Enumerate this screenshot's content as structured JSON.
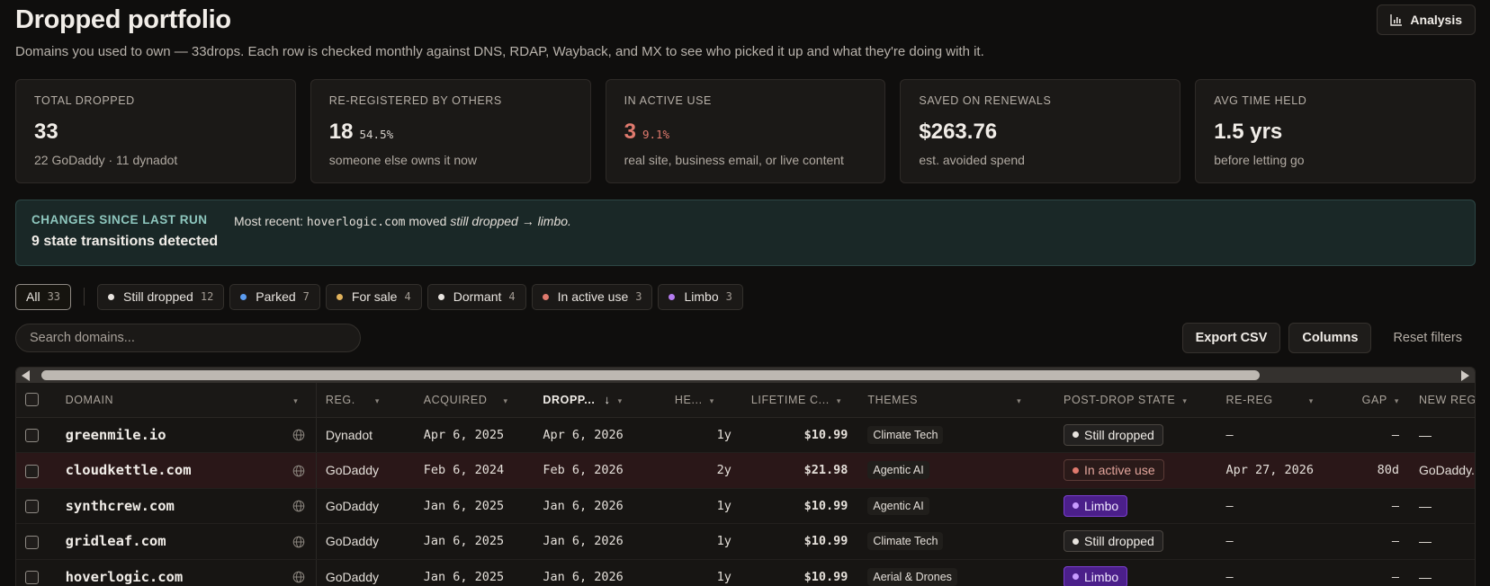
{
  "header": {
    "title": "Dropped portfolio",
    "subtitle": "Domains you used to own — 33drops. Each row is checked monthly against DNS, RDAP, Wayback, and MX to see who picked it up and what they're doing with it.",
    "analysis_label": "Analysis"
  },
  "cards": [
    {
      "label": "TOTAL DROPPED",
      "value": "33",
      "pct": "",
      "sub": "22 GoDaddy · 11 dynadot"
    },
    {
      "label": "RE-REGISTERED BY OTHERS",
      "value": "18",
      "pct": "54.5%",
      "sub": "someone else owns it now"
    },
    {
      "label": "IN ACTIVE USE",
      "value": "3",
      "pct": "9.1%",
      "sub": "real site, business email, or live content"
    },
    {
      "label": "SAVED ON RENEWALS",
      "value": "$263.76",
      "pct": "",
      "sub": "est. avoided spend"
    },
    {
      "label": "AVG TIME HELD",
      "value": "1.5 yrs",
      "pct": "",
      "sub": "before letting go"
    }
  ],
  "changes": {
    "label": "CHANGES SINCE LAST RUN",
    "count_text": "9 state transitions detected",
    "recent_prefix": "Most recent:",
    "recent_domain": "hoverlogic.com",
    "recent_verb": "moved",
    "recent_transition": "still dropped → limbo."
  },
  "filters": [
    {
      "label": "All",
      "count": "33",
      "dot": ""
    },
    {
      "label": "Still dropped",
      "count": "12",
      "dot": "#e8e4df"
    },
    {
      "label": "Parked",
      "count": "7",
      "dot": "#5b9cf0"
    },
    {
      "label": "For sale",
      "count": "4",
      "dot": "#e1b25c"
    },
    {
      "label": "Dormant",
      "count": "4",
      "dot": "#e8e4df"
    },
    {
      "label": "In active use",
      "count": "3",
      "dot": "#e07a6e"
    },
    {
      "label": "Limbo",
      "count": "3",
      "dot": "#b47cf0"
    }
  ],
  "search": {
    "placeholder": "Search domains..."
  },
  "actions": {
    "export": "Export CSV",
    "columns": "Columns",
    "reset": "Reset filters"
  },
  "table": {
    "columns": [
      "DOMAIN",
      "REG.",
      "ACQUIRED",
      "DROPP...",
      "HE...",
      "LIFETIME C...",
      "THEMES",
      "POST-DROP STATE",
      "RE-REG",
      "GAP",
      "NEW REGIS"
    ],
    "rows": [
      {
        "domain": "greenmile.io",
        "reg": "Dynadot",
        "acquired": "Apr 6, 2025",
        "dropped": "Apr 6, 2026",
        "held": "1y",
        "cost": "$10.99",
        "theme": "Climate Tech",
        "state": "Still dropped",
        "state_kind": "dropped",
        "rereg": "—",
        "gap": "—",
        "newreg": "—"
      },
      {
        "domain": "cloudkettle.com",
        "reg": "GoDaddy",
        "acquired": "Feb 6, 2024",
        "dropped": "Feb 6, 2026",
        "held": "2y",
        "cost": "$21.98",
        "theme": "Agentic AI",
        "state": "In active use",
        "state_kind": "active",
        "rereg": "Apr 27, 2026",
        "gap": "80d",
        "newreg": "GoDaddy.c"
      },
      {
        "domain": "synthcrew.com",
        "reg": "GoDaddy",
        "acquired": "Jan 6, 2025",
        "dropped": "Jan 6, 2026",
        "held": "1y",
        "cost": "$10.99",
        "theme": "Agentic AI",
        "state": "Limbo",
        "state_kind": "limbo",
        "rereg": "—",
        "gap": "—",
        "newreg": "—"
      },
      {
        "domain": "gridleaf.com",
        "reg": "GoDaddy",
        "acquired": "Jan 6, 2025",
        "dropped": "Jan 6, 2026",
        "held": "1y",
        "cost": "$10.99",
        "theme": "Climate Tech",
        "state": "Still dropped",
        "state_kind": "dropped",
        "rereg": "—",
        "gap": "—",
        "newreg": "—"
      },
      {
        "domain": "hoverlogic.com",
        "reg": "GoDaddy",
        "acquired": "Jan 6, 2025",
        "dropped": "Jan 6, 2026",
        "held": "1y",
        "cost": "$10.99",
        "theme": "Aerial & Drones",
        "state": "Limbo",
        "state_kind": "limbo",
        "rereg": "—",
        "gap": "—",
        "newreg": "—"
      }
    ]
  },
  "colors": {
    "accent_red": "#e07a6e",
    "limbo_purple": "#4b1f8a",
    "teal_banner": "#1a2827"
  }
}
